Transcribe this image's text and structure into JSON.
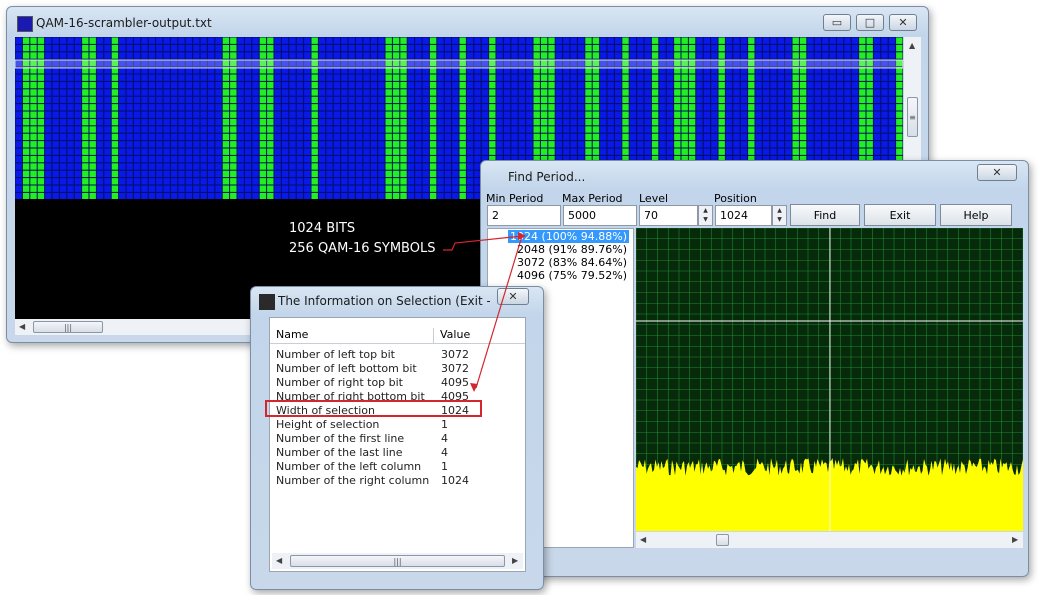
{
  "main_window": {
    "title": "QAM-16-scrambler-output.txt",
    "colors": {
      "background": "#000000",
      "cell_blue": "#0a18e8",
      "cell_green": "#22ee22"
    },
    "labels": {
      "bits": "1024 BITS",
      "symbols": "256  QAM-16 SYMBOLS"
    }
  },
  "find_period": {
    "title": "Find Period...",
    "fields": {
      "min_period": {
        "label": "Min Period",
        "value": "2"
      },
      "max_period": {
        "label": "Max Period",
        "value": "5000"
      },
      "level": {
        "label": "Level",
        "value": "70"
      },
      "position": {
        "label": "Position",
        "value": "1024"
      }
    },
    "buttons": {
      "find": "Find",
      "exit": "Exit",
      "help": "Help"
    },
    "periods": [
      {
        "label": "1024 (100% 94.88%)",
        "selected": true
      },
      {
        "label": "2048 (91% 89.76%)",
        "selected": false
      },
      {
        "label": "3072 (83% 84.64%)",
        "selected": false
      },
      {
        "label": "4096 (75% 79.52%)",
        "selected": false
      }
    ],
    "chart_colors": {
      "background": "#062a0a",
      "grid": "#1c8a32",
      "signal": "#ffff00"
    }
  },
  "info_window": {
    "title": "The Information on Selection (Exit - Es...",
    "columns": {
      "name": "Name",
      "value": "Value"
    },
    "rows": [
      {
        "name": "Number of left top bit",
        "value": "3072"
      },
      {
        "name": "Number of left bottom bit",
        "value": "3072"
      },
      {
        "name": "Number of right top bit",
        "value": "4095"
      },
      {
        "name": "Number of right bottom bit",
        "value": "4095"
      },
      {
        "name": "Width of selection",
        "value": "1024"
      },
      {
        "name": "Height of selection",
        "value": "1"
      },
      {
        "name": "Number of the first line",
        "value": "4"
      },
      {
        "name": "Number of the last line",
        "value": "4"
      },
      {
        "name": "Number of the left column",
        "value": "1"
      },
      {
        "name": "Number of the right column",
        "value": "1024"
      }
    ],
    "highlight_color": "#d3262d"
  }
}
